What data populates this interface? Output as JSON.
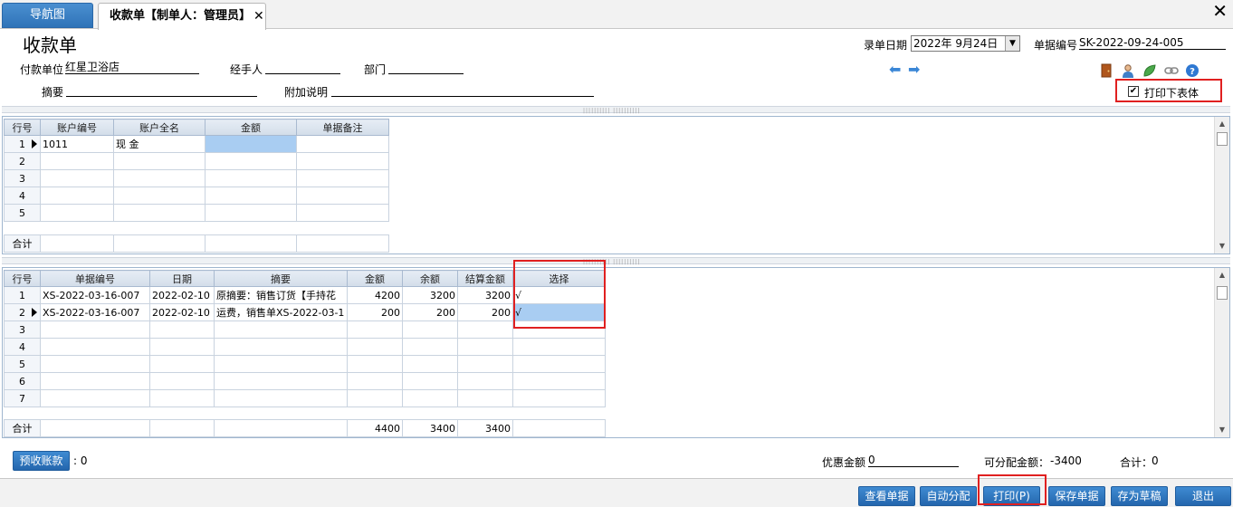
{
  "tabs": {
    "nav_label": "导航图",
    "active_label": "收款单【制单人：管理员】",
    "close_glyph": "✕",
    "window_close_glyph": "✕"
  },
  "header": {
    "title": "收款单",
    "date_label": "录单日期",
    "date_value": "2022年  9月24日",
    "docno_label": "单据编号",
    "docno_value": "SK-2022-09-24-005",
    "payer_label": "付款单位",
    "payer_value": "红星卫浴店",
    "handler_label": "经手人",
    "handler_value": "",
    "dept_label": "部门",
    "dept_value": "",
    "summary_label": "摘要",
    "summary_value": "",
    "note_label": "附加说明",
    "note_value": "",
    "print_table_label": "打印下表体",
    "print_table_checked": true
  },
  "toolbar_icons": [
    "arrow-left-icon",
    "arrow-right-icon",
    "door-icon",
    "user-icon",
    "leaf-icon",
    "link-icon",
    "help-icon"
  ],
  "upper_grid": {
    "columns": [
      "行号",
      "账户编号",
      "账户全名",
      "金额",
      "单据备注"
    ],
    "rows": [
      {
        "no": "1",
        "code": "1011",
        "name": "现  金",
        "amount": "",
        "note": ""
      },
      {
        "no": "2",
        "code": "",
        "name": "",
        "amount": "",
        "note": ""
      },
      {
        "no": "3",
        "code": "",
        "name": "",
        "amount": "",
        "note": ""
      },
      {
        "no": "4",
        "code": "",
        "name": "",
        "amount": "",
        "note": ""
      },
      {
        "no": "5",
        "code": "",
        "name": "",
        "amount": "",
        "note": ""
      }
    ],
    "total_label": "合计"
  },
  "lower_grid": {
    "columns": [
      "行号",
      "单据编号",
      "日期",
      "摘要",
      "金额",
      "余额",
      "结算金额",
      "选择"
    ],
    "rows": [
      {
        "no": "1",
        "docno": "XS-2022-03-16-007",
        "date": "2022-02-10",
        "summary": "原摘要：销售订货【手持花",
        "amount": "4200",
        "balance": "3200",
        "settle": "3200",
        "select": "√"
      },
      {
        "no": "2",
        "docno": "XS-2022-03-16-007",
        "date": "2022-02-10",
        "summary": "运费，销售单XS-2022-03-1",
        "amount": "200",
        "balance": "200",
        "settle": "200",
        "select": "√"
      },
      {
        "no": "3",
        "docno": "",
        "date": "",
        "summary": "",
        "amount": "",
        "balance": "",
        "settle": "",
        "select": ""
      },
      {
        "no": "4",
        "docno": "",
        "date": "",
        "summary": "",
        "amount": "",
        "balance": "",
        "settle": "",
        "select": ""
      },
      {
        "no": "5",
        "docno": "",
        "date": "",
        "summary": "",
        "amount": "",
        "balance": "",
        "settle": "",
        "select": ""
      },
      {
        "no": "6",
        "docno": "",
        "date": "",
        "summary": "",
        "amount": "",
        "balance": "",
        "settle": "",
        "select": ""
      },
      {
        "no": "7",
        "docno": "",
        "date": "",
        "summary": "",
        "amount": "",
        "balance": "",
        "settle": "",
        "select": ""
      }
    ],
    "total": {
      "label": "合计",
      "amount": "4400",
      "balance": "3400",
      "settle": "3400"
    }
  },
  "footer": {
    "prepay_button": "预收账款",
    "prepay_value": ": 0",
    "discount_label": "优惠金额",
    "discount_value": "0",
    "allocatable_label": "可分配金额：",
    "allocatable_value": "-3400",
    "sum_label": "合计：",
    "sum_value": "0"
  },
  "actions": {
    "view_doc": "查看单据",
    "auto_alloc": "自动分配",
    "print": "打印(P)",
    "save_doc": "保存单据",
    "save_draft": "存为草稿",
    "exit": "退出"
  }
}
